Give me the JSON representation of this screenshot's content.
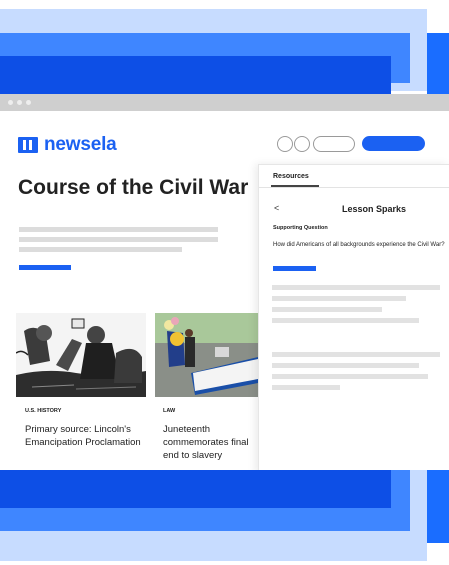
{
  "brand": {
    "name": "newsela",
    "color": "#1b61f2"
  },
  "page": {
    "title": "Course of the Civil War"
  },
  "articles": [
    {
      "tag": "U.S. HISTORY",
      "title": "Primary source: Lincoln's Emancipation Proclamation"
    },
    {
      "tag": "LAW",
      "title": "Juneteenth commemorates final end to slavery",
      "image_sign": "Happy Juneteenth Day"
    }
  ],
  "panel": {
    "tab": "Resources",
    "heading": "Lesson Sparks",
    "back_icon": "chevron-left-icon",
    "supporting_label": "Supporting Question",
    "question": "How did Americans of all backgrounds experience the Civil War?"
  },
  "colors": {
    "accent": "#1b61f2",
    "band_light": "#c7dcff",
    "band_mid": "#3f86ff",
    "band_dark": "#0d4fe6"
  }
}
